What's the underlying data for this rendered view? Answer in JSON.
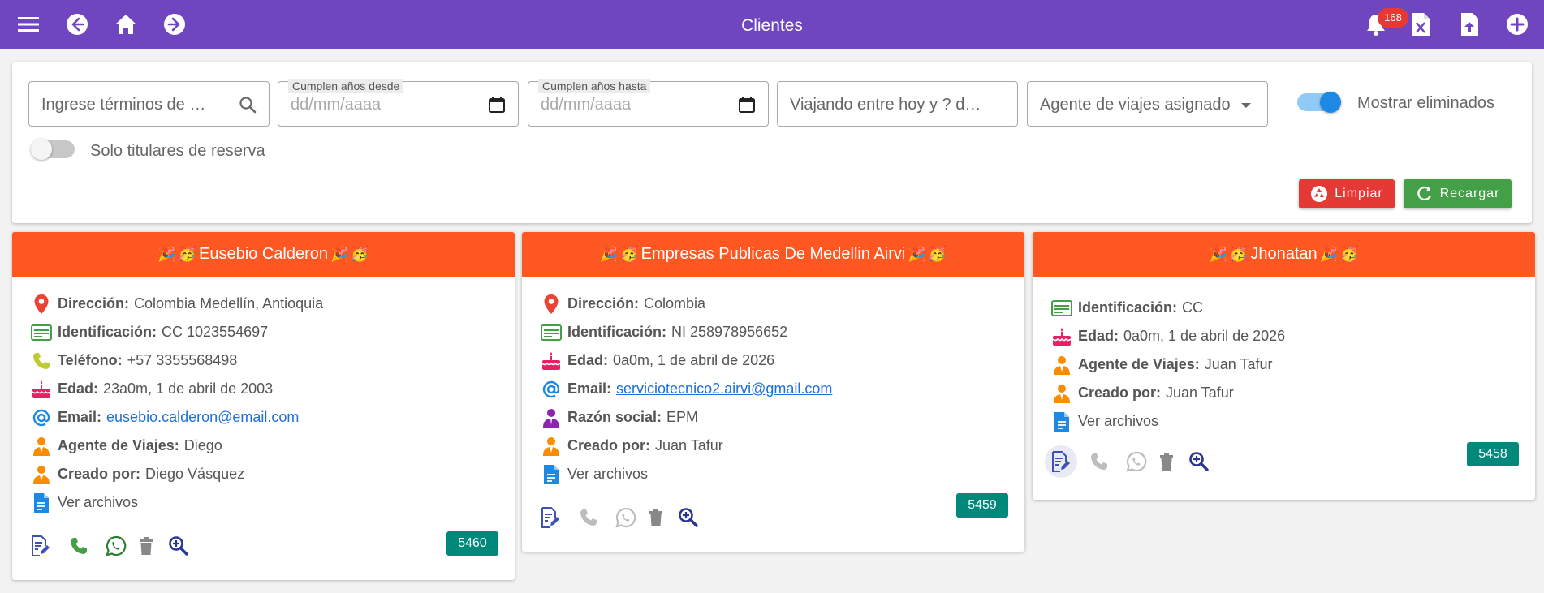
{
  "header": {
    "title": "Clientes",
    "notifications_count": "168"
  },
  "filters": {
    "search_placeholder": "Ingrese términos de …",
    "birthday_from_label": "Cumplen años desde",
    "birthday_from_placeholder": "dd/mm/aaaa",
    "birthday_to_label": "Cumplen años hasta",
    "birthday_to_placeholder": "dd/mm/aaaa",
    "traveling_placeholder": "Viajando entre hoy y ? d…",
    "agent_select_placeholder": "Agente de viajes asignado",
    "show_deleted_label": "Mostrar eliminados",
    "show_deleted_on": true,
    "only_holders_label": "Solo titulares de reserva",
    "only_holders_on": false,
    "clear_label": "Limpiar",
    "reload_label": "Recargar"
  },
  "colors": {
    "topbar": "#6f45c0",
    "card_header": "#ff5722",
    "id_badge": "#00897b",
    "clear_button": "#e53935",
    "reload_button": "#43a047"
  },
  "cards": [
    {
      "name": "Eusebio Calderon",
      "header_emojis": [
        "🎉",
        "🥳"
      ],
      "rows": [
        {
          "icon": "location-icon",
          "label": "Dirección:",
          "value": "Colombia Medellín, Antioquia"
        },
        {
          "icon": "id-card-icon",
          "label": "Identificación:",
          "value": "CC 1023554697"
        },
        {
          "icon": "phone-icon",
          "label": "Teléfono:",
          "value": "+57 3355568498"
        },
        {
          "icon": "cake-icon",
          "label": "Edad:",
          "value": "23a0m, 1 de abril de 2003"
        },
        {
          "icon": "email-icon",
          "label": "Email:",
          "value": "eusebio.calderon@email.com"
        },
        {
          "icon": "agent-icon",
          "label": "Agente de Viajes:",
          "value": "Diego"
        },
        {
          "icon": "agent-icon",
          "label": "Creado por:",
          "value": "Diego Vásquez"
        },
        {
          "icon": "file-icon",
          "label": "",
          "value": "Ver archivos"
        }
      ],
      "id": "5460"
    },
    {
      "name": "Empresas Publicas De Medellin Airvi",
      "header_emojis": [
        "🎉",
        "🥳"
      ],
      "rows": [
        {
          "icon": "location-icon",
          "label": "Dirección:",
          "value": "Colombia"
        },
        {
          "icon": "id-card-icon",
          "label": "Identificación:",
          "value": "NI 258978956652"
        },
        {
          "icon": "cake-icon",
          "label": "Edad:",
          "value": "0a0m, 1 de abril de 2026"
        },
        {
          "icon": "email-icon",
          "label": "Email:",
          "value": "serviciotecnico2.airvi@gmail.com"
        },
        {
          "icon": "business-person-icon",
          "label": "Razón social:",
          "value": "EPM"
        },
        {
          "icon": "agent-icon",
          "label": "Creado por:",
          "value": "Juan Tafur"
        },
        {
          "icon": "file-icon",
          "label": "",
          "value": "Ver archivos"
        }
      ],
      "id": "5459"
    },
    {
      "name": "Jhonatan",
      "header_emojis": [
        "🎉",
        "🥳"
      ],
      "rows": [
        {
          "icon": "id-card-icon",
          "label": "Identificación:",
          "value": "CC"
        },
        {
          "icon": "cake-icon",
          "label": "Edad:",
          "value": "0a0m, 1 de abril de 2026"
        },
        {
          "icon": "agent-icon",
          "label": "Agente de Viajes:",
          "value": "Juan Tafur"
        },
        {
          "icon": "agent-icon",
          "label": "Creado por:",
          "value": "Juan Tafur"
        },
        {
          "icon": "file-icon",
          "label": "",
          "value": "Ver archivos"
        }
      ],
      "id": "5458"
    }
  ]
}
